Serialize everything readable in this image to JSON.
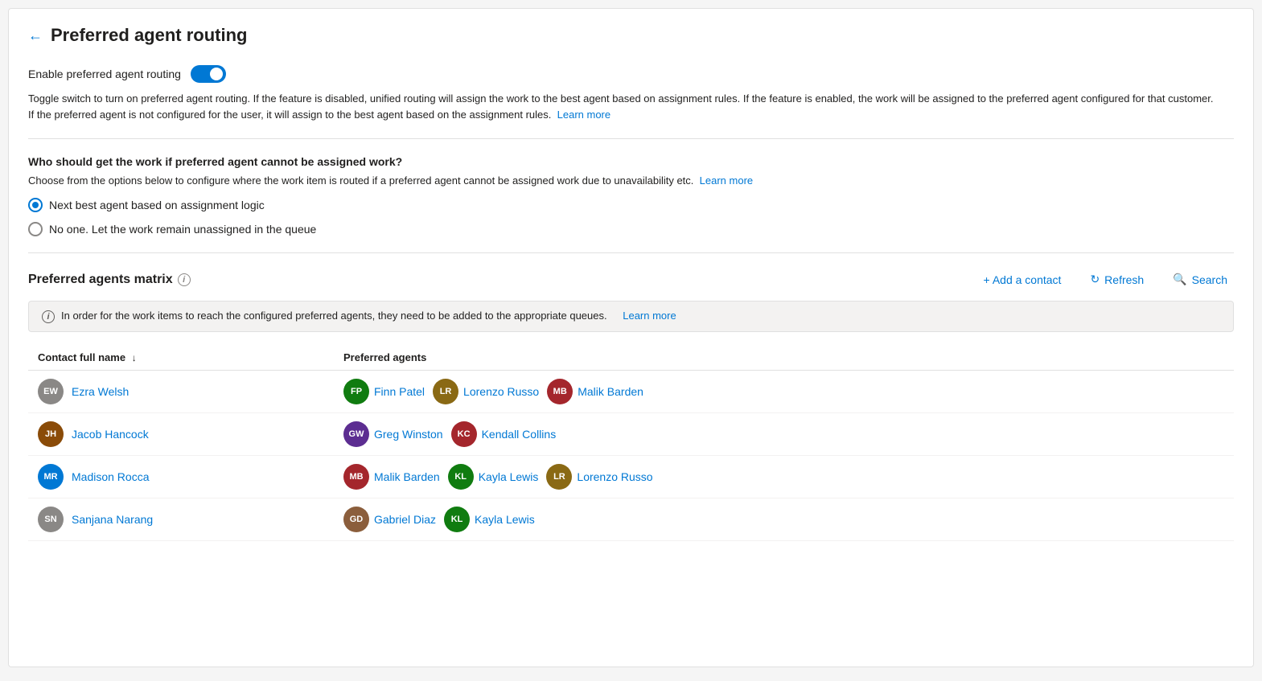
{
  "page": {
    "title": "Preferred agent routing",
    "back_label": "←"
  },
  "toggle": {
    "label": "Enable preferred agent routing",
    "enabled": true,
    "description": "Toggle switch to turn on preferred agent routing. If the feature is disabled, unified routing will assign the work to the best agent based on assignment rules. If the feature is enabled, the work will be assigned to the preferred agent configured for that customer. If the preferred agent is not configured for the user, it will assign to the best agent based on the assignment rules.",
    "learn_more": "Learn more"
  },
  "fallback": {
    "question": "Who should get the work if preferred agent cannot be assigned work?",
    "description": "Choose from the options below to configure where the work item is routed if a preferred agent cannot be assigned work due to unavailability etc.",
    "learn_more": "Learn more",
    "options": [
      {
        "id": "next_best",
        "label": "Next best agent based on assignment logic",
        "selected": true
      },
      {
        "id": "no_one",
        "label": "No one. Let the work remain unassigned in the queue",
        "selected": false
      }
    ]
  },
  "matrix": {
    "title": "Preferred agents matrix",
    "info": "i",
    "add_contact_label": "+ Add a contact",
    "refresh_label": "Refresh",
    "search_label": "Search",
    "banner_text": "In order for the work items to reach the configured preferred agents, they need to be added to the appropriate queues.",
    "banner_learn_more": "Learn more",
    "columns": {
      "contact": "Contact full name",
      "agents": "Preferred agents"
    },
    "rows": [
      {
        "contact": {
          "name": "Ezra Welsh",
          "initials": "EW",
          "color": "#8a8886"
        },
        "agents": [
          {
            "name": "Finn Patel",
            "initials": "FP",
            "color": "#107c10"
          },
          {
            "name": "Lorenzo Russo",
            "initials": "LR",
            "color": "#8a6914"
          },
          {
            "name": "Malik Barden",
            "initials": "MB",
            "color": "#a4262c"
          }
        ]
      },
      {
        "contact": {
          "name": "Jacob Hancock",
          "initials": "JH",
          "color": "#8a4b08"
        },
        "agents": [
          {
            "name": "Greg Winston",
            "initials": "GW",
            "color": "#5c2d91"
          },
          {
            "name": "Kendall Collins",
            "initials": "KC",
            "color": "#a4262c"
          }
        ]
      },
      {
        "contact": {
          "name": "Madison Rocca",
          "initials": "MR",
          "color": "#0078d4"
        },
        "agents": [
          {
            "name": "Malik Barden",
            "initials": "MB",
            "color": "#a4262c"
          },
          {
            "name": "Kayla Lewis",
            "initials": "KL",
            "color": "#107c10"
          },
          {
            "name": "Lorenzo Russo",
            "initials": "LR",
            "color": "#8a6914"
          }
        ]
      },
      {
        "contact": {
          "name": "Sanjana Narang",
          "initials": "SN",
          "color": "#8a8886"
        },
        "agents": [
          {
            "name": "Gabriel Diaz",
            "initials": "GD",
            "color": "#8b5e3c"
          },
          {
            "name": "Kayla Lewis",
            "initials": "KL",
            "color": "#107c10"
          }
        ]
      }
    ]
  }
}
